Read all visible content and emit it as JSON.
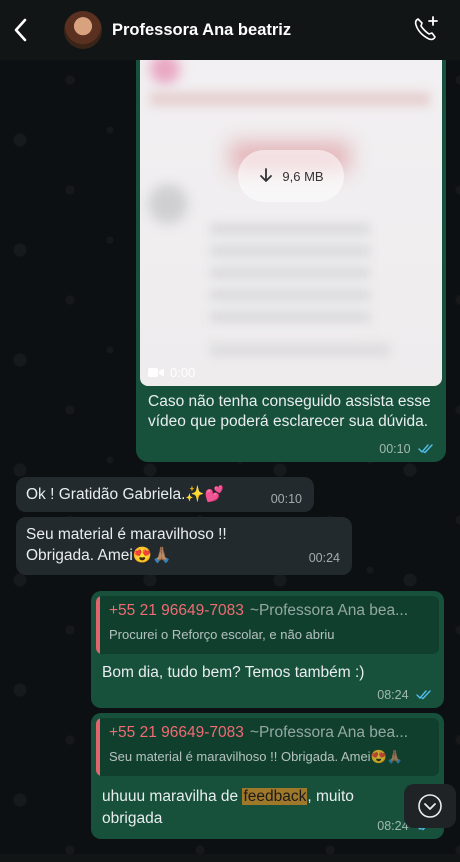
{
  "header": {
    "contact_name": "Professora Ana beatriz"
  },
  "video_message": {
    "file_size": "9,6 MB",
    "duration": "0:00",
    "caption": "Caso não tenha conseguido assista esse vídeo que poderá esclarecer sua dúvida.",
    "time": "00:10"
  },
  "incoming": [
    {
      "text": "Ok ! Gratidão Gabriela.✨💕",
      "time": "00:10"
    },
    {
      "text": "Seu material é maravilhoso !! Obrigada. Amei😍🙏🏽",
      "time": "00:24"
    }
  ],
  "replies": [
    {
      "quote_number": "+55 21 96649-7083",
      "quote_name": "~Professora Ana bea...",
      "quote_text": "Procurei o Reforço escolar, e não abriu",
      "text": "Bom dia, tudo bem? Temos também :)",
      "time": "08:24"
    },
    {
      "quote_number": "+55 21 96649-7083",
      "quote_name": "~Professora Ana bea...",
      "quote_text": "Seu material é maravilhoso !! Obrigada. Amei😍🙏🏽",
      "text_before": "uhuuu maravilha de ",
      "text_highlight": "feedback",
      "text_after": ", muito obrigada",
      "time": "08:24"
    }
  ],
  "colors": {
    "outgoing_bubble": "#17513c",
    "incoming_bubble": "#232a2e",
    "quote_accent": "#f06b72",
    "read_checks": "#53bdeb"
  },
  "icons": [
    "back-chevron-icon",
    "add-call-icon",
    "download-icon",
    "video-camera-icon",
    "double-check-icon",
    "chevron-down-icon"
  ]
}
